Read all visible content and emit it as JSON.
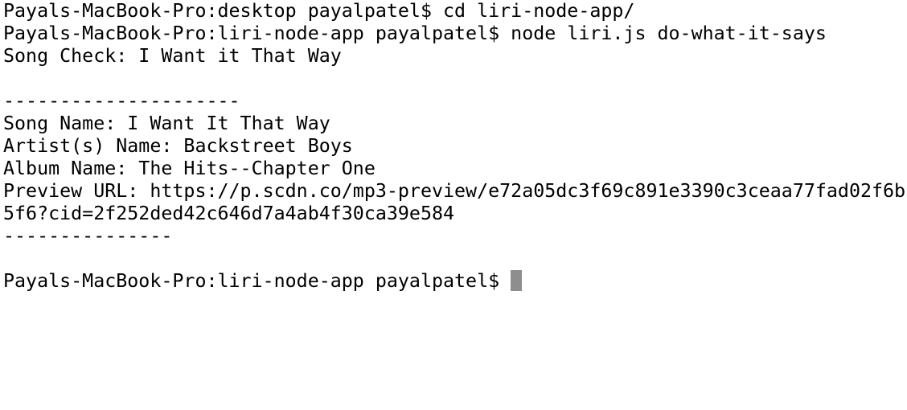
{
  "terminal": {
    "lines": [
      "Payals-MacBook-Pro:desktop payalpatel$ cd liri-node-app/",
      "Payals-MacBook-Pro:liri-node-app payalpatel$ node liri.js do-what-it-says",
      "Song Check: I Want it That Way",
      "",
      "---------------------",
      "Song Name: I Want It That Way",
      "Artist(s) Name: Backstreet Boys",
      "Album Name: The Hits--Chapter One",
      "Preview URL: https://p.scdn.co/mp3-preview/e72a05dc3f69c891e3390c3ceaa77fad02f6b",
      "5f6?cid=2f252ded42c646d7a4ab4f30ca39e584",
      "---------------",
      "",
      "Payals-MacBook-Pro:liri-node-app payalpatel$ "
    ],
    "colors": {
      "background": "#ffffff",
      "text": "#000000",
      "cursor": "#8e8e8e"
    }
  }
}
